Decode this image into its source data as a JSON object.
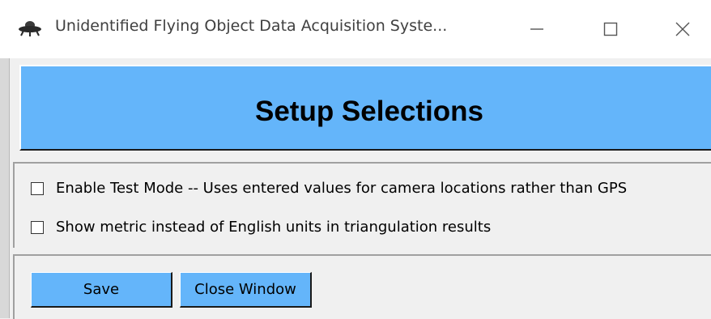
{
  "window": {
    "title": "Unidentified Flying Object Data Acquisition Syste...",
    "icon": "ufo-icon",
    "controls": {
      "minimize": "—",
      "maximize": "☐",
      "close": "✕"
    }
  },
  "header": {
    "title": "Setup Selections",
    "color": "#64b5fa"
  },
  "options": [
    {
      "label": "Enable Test Mode -- Uses entered values for camera locations rather than GPS",
      "checked": false
    },
    {
      "label": "Show metric instead of English units in triangulation results",
      "checked": false
    }
  ],
  "buttons": {
    "save": "Save",
    "close_window": "Close Window"
  }
}
